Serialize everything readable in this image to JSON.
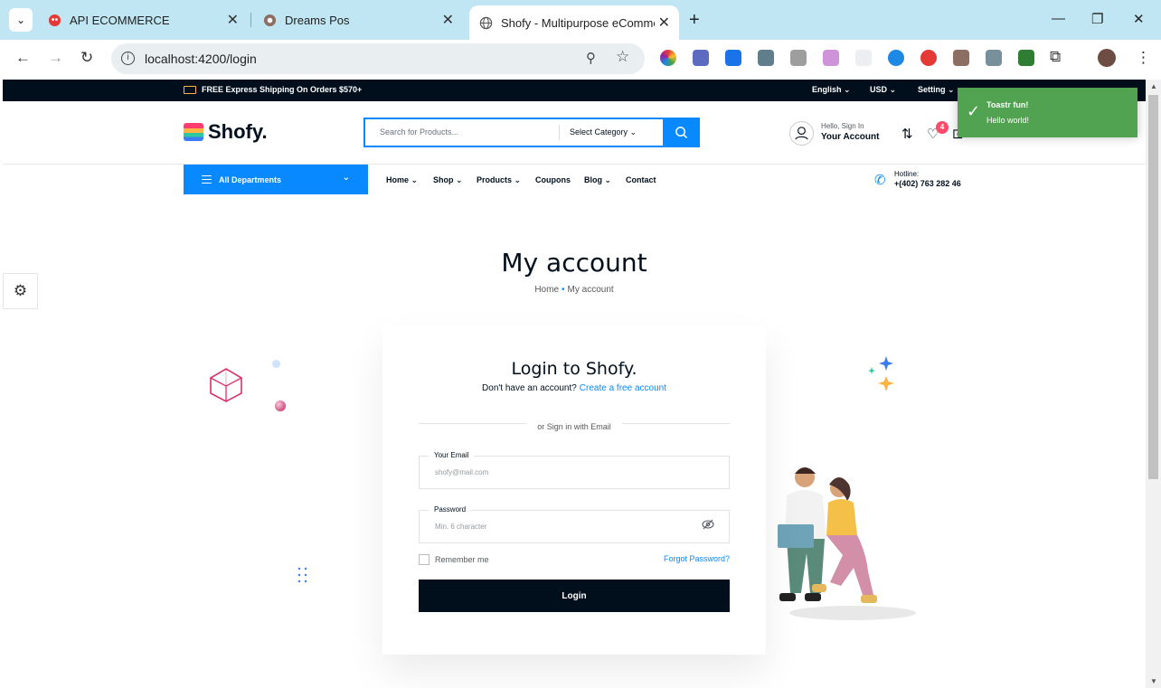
{
  "browser": {
    "tabs": [
      {
        "title": "API ECOMMERCE"
      },
      {
        "title": "Dreams Pos"
      },
      {
        "title": "Shofy - Multipurpose eCommer"
      }
    ],
    "url": "localhost:4200/login"
  },
  "topbar": {
    "shipping": "FREE Express Shipping On Orders $570+",
    "language": "English",
    "currency": "USD",
    "setting": "Setting"
  },
  "header": {
    "logo": "Shofy.",
    "search_placeholder": "Search for Products...",
    "category": "Select Category",
    "account_hello": "Hello, Sign In",
    "account_label": "Your Account",
    "wishlist_count": "4"
  },
  "nav": {
    "departments": "All Departments",
    "items": [
      "Home",
      "Shop",
      "Products",
      "Coupons",
      "Blog",
      "Contact"
    ],
    "hotline_label": "Hotline:",
    "hotline_number": "+(402) 763 282 46"
  },
  "toast": {
    "title": "Toastr fun!",
    "message": "Hello world!",
    "color": "#51a351"
  },
  "breadcrumb": {
    "title": "My account",
    "home": "Home",
    "current": "My account"
  },
  "login": {
    "heading": "Login to Shofy.",
    "no_account": "Don't have an account?",
    "create_link": "Create a free account",
    "divider": "or Sign in with Email",
    "email_label": "Your Email",
    "email_placeholder": "shofy@mail.com",
    "password_label": "Password",
    "password_placeholder": "Min. 6 character",
    "remember": "Remember me",
    "forgot": "Forgot Password?",
    "button": "Login"
  },
  "colors": {
    "accent": "#0989ff",
    "dark": "#010f1c"
  }
}
